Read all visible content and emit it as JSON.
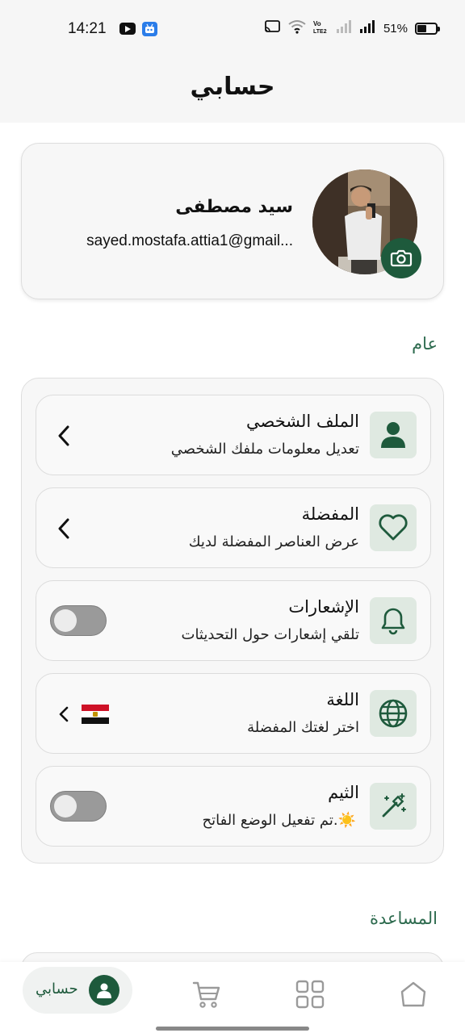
{
  "status_bar": {
    "time": "14:21",
    "battery_text": "51%",
    "battery_level": 0.51,
    "icons": [
      "youtube-icon",
      "bot-icon",
      "cast-icon",
      "wifi-icon",
      "volte-icon",
      "signal-icon",
      "signal-icon",
      "battery-icon"
    ]
  },
  "header": {
    "title": "حسابي"
  },
  "profile": {
    "name": "سيد مصطفى",
    "email": "sayed.mostafa.attia1@gmail...",
    "camera_icon": "camera-icon"
  },
  "sections": {
    "general_title": "عام",
    "help_title": "المساعدة"
  },
  "settings": [
    {
      "title": "الملف الشخصي",
      "subtitle": "تعديل معلومات ملفك الشخصي",
      "icon": "user-icon",
      "control": "chevron"
    },
    {
      "title": "المفضلة",
      "subtitle": "عرض العناصر المفضلة لديك",
      "icon": "heart-icon",
      "control": "chevron"
    },
    {
      "title": "الإشعارات",
      "subtitle": "تلقي إشعارات حول التحديثات",
      "icon": "bell-icon",
      "control": "toggle",
      "on": false
    },
    {
      "title": "اللغة",
      "subtitle": "اختر لغتك المفضلة",
      "icon": "globe-icon",
      "control": "chevron",
      "flag": "egypt-flag"
    },
    {
      "title": "الثيم",
      "subtitle": "تم تفعيل الوضع الفاتح.",
      "icon": "magic-wand-icon",
      "control": "toggle",
      "on": false,
      "emoji": "☀️"
    }
  ],
  "bottom_nav": {
    "active_label": "حسابي",
    "items": [
      "account-icon",
      "cart-icon",
      "grid-icon",
      "home-icon"
    ]
  },
  "colors": {
    "primary": "#1e5a3c",
    "section_title": "#2e6b4f",
    "icon_bg": "#dfe9e1",
    "card_bg": "#f7f7f7",
    "toggle_off": "#9a9a9a"
  }
}
